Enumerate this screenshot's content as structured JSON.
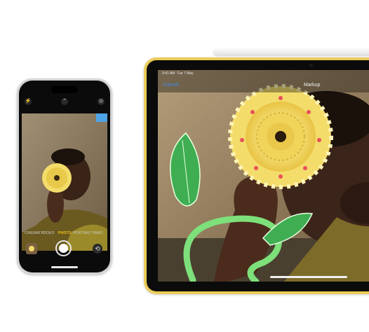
{
  "iphone": {
    "modes": [
      "CINEMATIC",
      "VIDEO",
      "PHOTO",
      "PORTRAIT",
      "PANO"
    ],
    "active_mode": "PHOTO",
    "icons": {
      "flash": "flash-icon",
      "chevron": "chevron-up-icon",
      "live": "live-photo-icon",
      "flip": "camera-flip-icon",
      "shutter": "shutter-icon"
    }
  },
  "ipad": {
    "status_time": "9:41 AM",
    "status_date": "Tue 7 May",
    "cancel_label": "Cancel",
    "title": "Markup"
  },
  "colors": {
    "ipad_frame": "#e9cc5a",
    "accent_blue": "#3d8ef0",
    "mode_active": "#f5c518",
    "leaf_green": "#3fae52",
    "stroke_green": "#7de07a",
    "flower_yellow": "#f3dc6a"
  }
}
